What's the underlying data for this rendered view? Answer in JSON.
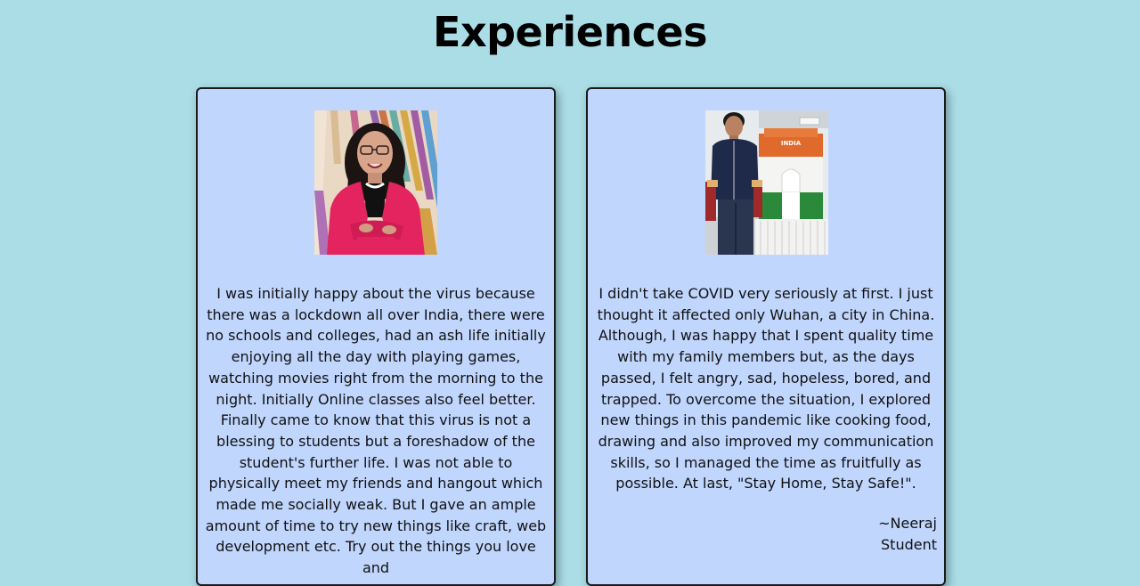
{
  "page": {
    "title": "Experiences",
    "background_color": "#aadde6",
    "card_color": "#c0d6fd"
  },
  "cards": [
    {
      "photo_icon": "woman-portrait-photo",
      "text": "I was initially happy about the virus because there was a lockdown all over India, there were no schools and colleges, had an ash life initially enjoying all the day with playing games, watching movies right from the morning to the night. Initially Online classes also feel better. Finally came to know that this virus is not a blessing to students but a foreshadow of the student's further life. I was not able to physically meet my friends and hangout which made me socially weak. But I gave an ample amount of time to try new things like craft, web development etc. Try out the things you love and"
    },
    {
      "photo_icon": "man-with-india-gate-model-photo",
      "text": "I didn't take COVID very seriously at first. I just thought it affected only Wuhan, a city in China. Although, I was happy that I spent quality time with my family members but, as the days passed, I felt angry, sad, hopeless, bored, and trapped. To overcome the situation, I explored new things in this pandemic like cooking food, drawing and also improved my communication skills, so I managed the time as fruitfully as possible. At last, \"Stay Home, Stay Safe!\".",
      "author": "~Neeraj",
      "role": "Student",
      "model_label": "INDIA"
    }
  ]
}
